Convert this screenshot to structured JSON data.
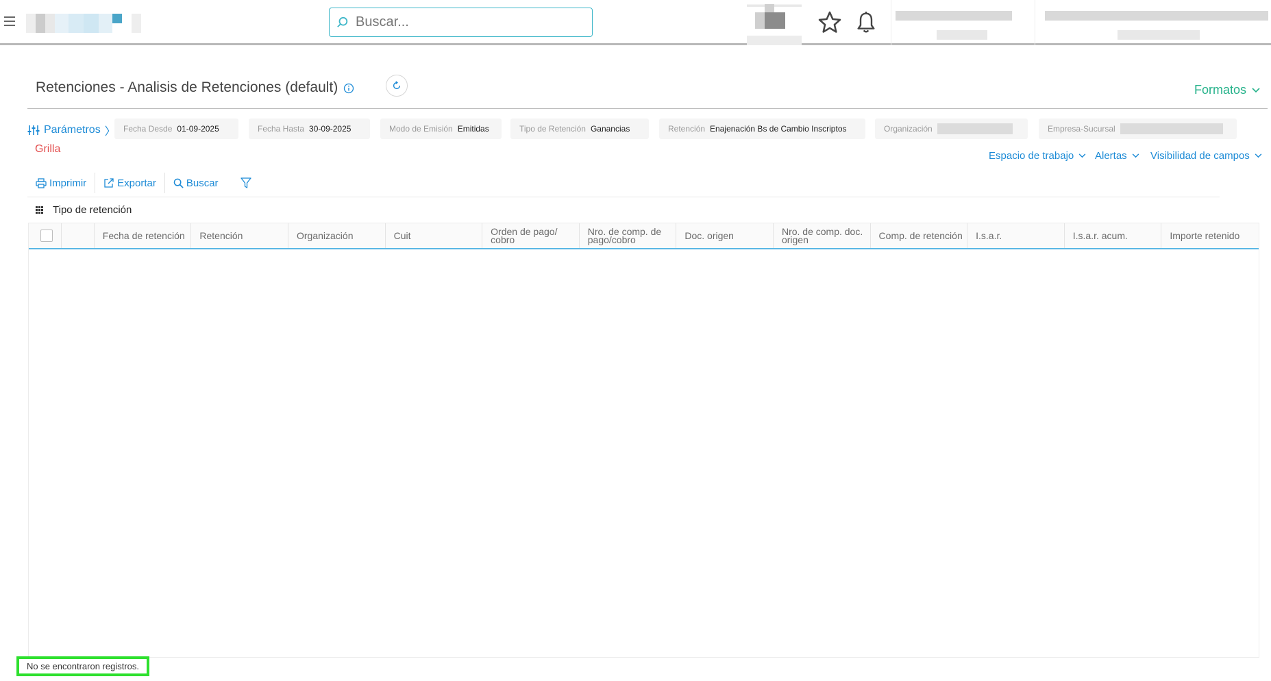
{
  "topbar": {
    "search_placeholder": "Buscar..."
  },
  "header": {
    "title": "Retenciones - Analisis de Retenciones (default)",
    "formatos_label": "Formatos"
  },
  "parameters": {
    "link_label": "Parámetros",
    "items": [
      {
        "label": "Fecha Desde",
        "value": "01-09-2025"
      },
      {
        "label": "Fecha Hasta",
        "value": "30-09-2025"
      },
      {
        "label": "Modo de Emisión",
        "value": "Emitidas"
      },
      {
        "label": "Tipo de Retención",
        "value": "Ganancias"
      },
      {
        "label": "Retención",
        "value": "Enajenación Bs de Cambio Inscriptos"
      },
      {
        "label": "Organización",
        "value": ""
      },
      {
        "label": "Empresa-Sucursal",
        "value": ""
      }
    ]
  },
  "view": {
    "grilla_label": "Grilla",
    "espacio_label": "Espacio de trabajo",
    "alertas_label": "Alertas",
    "visibilidad_label": "Visibilidad de campos"
  },
  "toolbar": {
    "imprimir": "Imprimir",
    "exportar": "Exportar",
    "buscar": "Buscar"
  },
  "grouping": {
    "label": "Tipo de retención"
  },
  "grid": {
    "columns": [
      "Fecha de retención",
      "Retención",
      "Organización",
      "Cuit",
      "Orden de pago/ cobro",
      "Nro. de comp. de pago/cobro",
      "Doc. origen",
      "Nro. de comp. doc. origen",
      "Comp. de retención",
      "I.s.a.r.",
      "I.s.a.r. acum.",
      "Importe retenido"
    ],
    "rows": []
  },
  "status": {
    "message": "No se encontraron registros."
  },
  "colors": {
    "accent": "#1b8ad6",
    "formatos": "#25b28a",
    "grilla": "#e35050",
    "search_border": "#3fb7c9",
    "status_border": "#2ee02e"
  }
}
